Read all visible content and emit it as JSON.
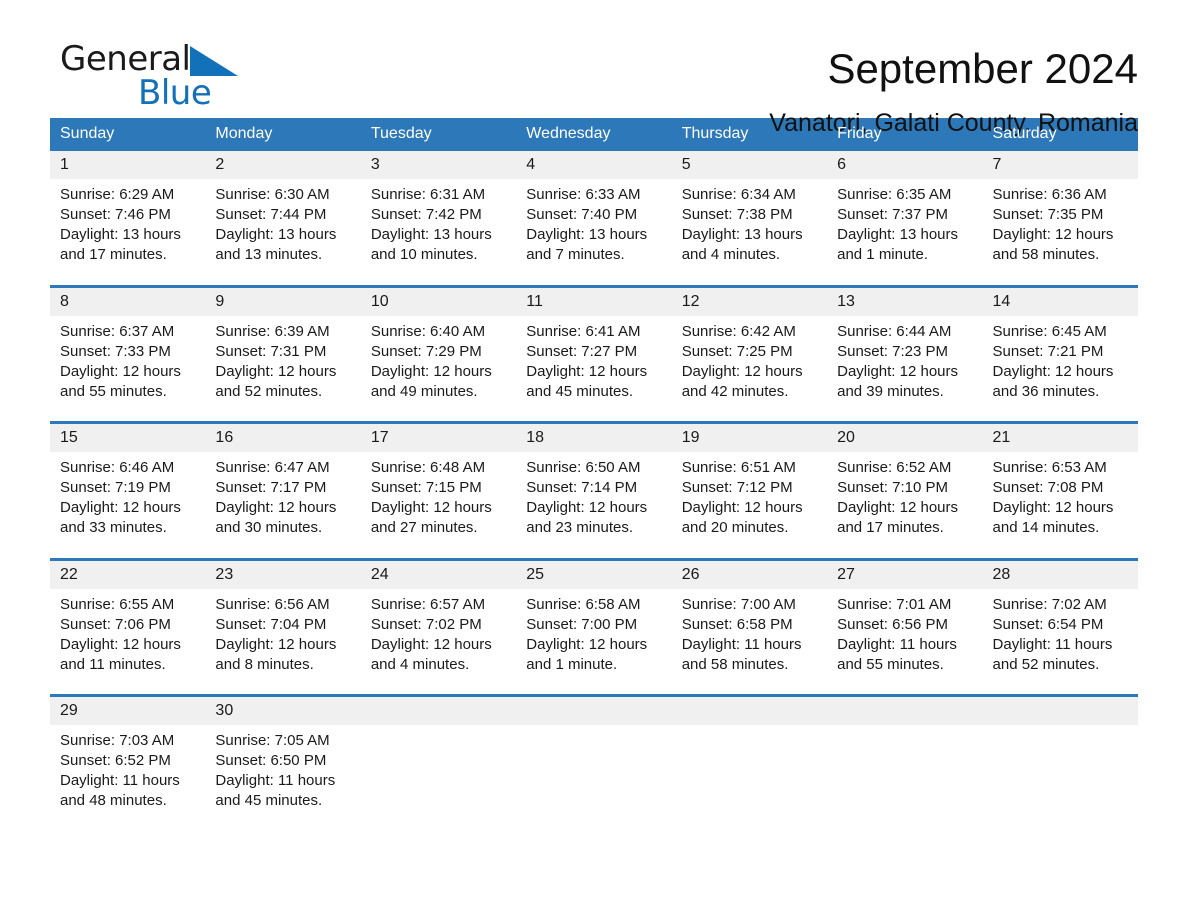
{
  "logo": {
    "text_dark": "General",
    "text_blue": "Blue",
    "triangle_color": "#1271b8",
    "icon": "triangle-icon"
  },
  "header": {
    "title": "September 2024",
    "subtitle": "Vanatori, Galati County, Romania"
  },
  "colors": {
    "header_blue": "#2c78b8",
    "daynum_band": "#f0f0f0",
    "text": "#1a1a1a",
    "page_background": "#ffffff"
  },
  "calendar": {
    "weekday_headers": [
      "Sunday",
      "Monday",
      "Tuesday",
      "Wednesday",
      "Thursday",
      "Friday",
      "Saturday"
    ],
    "weeks": [
      [
        {
          "day": "1",
          "sunrise": "Sunrise: 6:29 AM",
          "sunset": "Sunset: 7:46 PM",
          "daylight_line1": "Daylight: 13 hours",
          "daylight_line2": "and 17 minutes."
        },
        {
          "day": "2",
          "sunrise": "Sunrise: 6:30 AM",
          "sunset": "Sunset: 7:44 PM",
          "daylight_line1": "Daylight: 13 hours",
          "daylight_line2": "and 13 minutes."
        },
        {
          "day": "3",
          "sunrise": "Sunrise: 6:31 AM",
          "sunset": "Sunset: 7:42 PM",
          "daylight_line1": "Daylight: 13 hours",
          "daylight_line2": "and 10 minutes."
        },
        {
          "day": "4",
          "sunrise": "Sunrise: 6:33 AM",
          "sunset": "Sunset: 7:40 PM",
          "daylight_line1": "Daylight: 13 hours",
          "daylight_line2": "and 7 minutes."
        },
        {
          "day": "5",
          "sunrise": "Sunrise: 6:34 AM",
          "sunset": "Sunset: 7:38 PM",
          "daylight_line1": "Daylight: 13 hours",
          "daylight_line2": "and 4 minutes."
        },
        {
          "day": "6",
          "sunrise": "Sunrise: 6:35 AM",
          "sunset": "Sunset: 7:37 PM",
          "daylight_line1": "Daylight: 13 hours",
          "daylight_line2": "and 1 minute."
        },
        {
          "day": "7",
          "sunrise": "Sunrise: 6:36 AM",
          "sunset": "Sunset: 7:35 PM",
          "daylight_line1": "Daylight: 12 hours",
          "daylight_line2": "and 58 minutes."
        }
      ],
      [
        {
          "day": "8",
          "sunrise": "Sunrise: 6:37 AM",
          "sunset": "Sunset: 7:33 PM",
          "daylight_line1": "Daylight: 12 hours",
          "daylight_line2": "and 55 minutes."
        },
        {
          "day": "9",
          "sunrise": "Sunrise: 6:39 AM",
          "sunset": "Sunset: 7:31 PM",
          "daylight_line1": "Daylight: 12 hours",
          "daylight_line2": "and 52 minutes."
        },
        {
          "day": "10",
          "sunrise": "Sunrise: 6:40 AM",
          "sunset": "Sunset: 7:29 PM",
          "daylight_line1": "Daylight: 12 hours",
          "daylight_line2": "and 49 minutes."
        },
        {
          "day": "11",
          "sunrise": "Sunrise: 6:41 AM",
          "sunset": "Sunset: 7:27 PM",
          "daylight_line1": "Daylight: 12 hours",
          "daylight_line2": "and 45 minutes."
        },
        {
          "day": "12",
          "sunrise": "Sunrise: 6:42 AM",
          "sunset": "Sunset: 7:25 PM",
          "daylight_line1": "Daylight: 12 hours",
          "daylight_line2": "and 42 minutes."
        },
        {
          "day": "13",
          "sunrise": "Sunrise: 6:44 AM",
          "sunset": "Sunset: 7:23 PM",
          "daylight_line1": "Daylight: 12 hours",
          "daylight_line2": "and 39 minutes."
        },
        {
          "day": "14",
          "sunrise": "Sunrise: 6:45 AM",
          "sunset": "Sunset: 7:21 PM",
          "daylight_line1": "Daylight: 12 hours",
          "daylight_line2": "and 36 minutes."
        }
      ],
      [
        {
          "day": "15",
          "sunrise": "Sunrise: 6:46 AM",
          "sunset": "Sunset: 7:19 PM",
          "daylight_line1": "Daylight: 12 hours",
          "daylight_line2": "and 33 minutes."
        },
        {
          "day": "16",
          "sunrise": "Sunrise: 6:47 AM",
          "sunset": "Sunset: 7:17 PM",
          "daylight_line1": "Daylight: 12 hours",
          "daylight_line2": "and 30 minutes."
        },
        {
          "day": "17",
          "sunrise": "Sunrise: 6:48 AM",
          "sunset": "Sunset: 7:15 PM",
          "daylight_line1": "Daylight: 12 hours",
          "daylight_line2": "and 27 minutes."
        },
        {
          "day": "18",
          "sunrise": "Sunrise: 6:50 AM",
          "sunset": "Sunset: 7:14 PM",
          "daylight_line1": "Daylight: 12 hours",
          "daylight_line2": "and 23 minutes."
        },
        {
          "day": "19",
          "sunrise": "Sunrise: 6:51 AM",
          "sunset": "Sunset: 7:12 PM",
          "daylight_line1": "Daylight: 12 hours",
          "daylight_line2": "and 20 minutes."
        },
        {
          "day": "20",
          "sunrise": "Sunrise: 6:52 AM",
          "sunset": "Sunset: 7:10 PM",
          "daylight_line1": "Daylight: 12 hours",
          "daylight_line2": "and 17 minutes."
        },
        {
          "day": "21",
          "sunrise": "Sunrise: 6:53 AM",
          "sunset": "Sunset: 7:08 PM",
          "daylight_line1": "Daylight: 12 hours",
          "daylight_line2": "and 14 minutes."
        }
      ],
      [
        {
          "day": "22",
          "sunrise": "Sunrise: 6:55 AM",
          "sunset": "Sunset: 7:06 PM",
          "daylight_line1": "Daylight: 12 hours",
          "daylight_line2": "and 11 minutes."
        },
        {
          "day": "23",
          "sunrise": "Sunrise: 6:56 AM",
          "sunset": "Sunset: 7:04 PM",
          "daylight_line1": "Daylight: 12 hours",
          "daylight_line2": "and 8 minutes."
        },
        {
          "day": "24",
          "sunrise": "Sunrise: 6:57 AM",
          "sunset": "Sunset: 7:02 PM",
          "daylight_line1": "Daylight: 12 hours",
          "daylight_line2": "and 4 minutes."
        },
        {
          "day": "25",
          "sunrise": "Sunrise: 6:58 AM",
          "sunset": "Sunset: 7:00 PM",
          "daylight_line1": "Daylight: 12 hours",
          "daylight_line2": "and 1 minute."
        },
        {
          "day": "26",
          "sunrise": "Sunrise: 7:00 AM",
          "sunset": "Sunset: 6:58 PM",
          "daylight_line1": "Daylight: 11 hours",
          "daylight_line2": "and 58 minutes."
        },
        {
          "day": "27",
          "sunrise": "Sunrise: 7:01 AM",
          "sunset": "Sunset: 6:56 PM",
          "daylight_line1": "Daylight: 11 hours",
          "daylight_line2": "and 55 minutes."
        },
        {
          "day": "28",
          "sunrise": "Sunrise: 7:02 AM",
          "sunset": "Sunset: 6:54 PM",
          "daylight_line1": "Daylight: 11 hours",
          "daylight_line2": "and 52 minutes."
        }
      ],
      [
        {
          "day": "29",
          "sunrise": "Sunrise: 7:03 AM",
          "sunset": "Sunset: 6:52 PM",
          "daylight_line1": "Daylight: 11 hours",
          "daylight_line2": "and 48 minutes."
        },
        {
          "day": "30",
          "sunrise": "Sunrise: 7:05 AM",
          "sunset": "Sunset: 6:50 PM",
          "daylight_line1": "Daylight: 11 hours",
          "daylight_line2": "and 45 minutes."
        },
        {
          "day": "",
          "sunrise": "",
          "sunset": "",
          "daylight_line1": "",
          "daylight_line2": ""
        },
        {
          "day": "",
          "sunrise": "",
          "sunset": "",
          "daylight_line1": "",
          "daylight_line2": ""
        },
        {
          "day": "",
          "sunrise": "",
          "sunset": "",
          "daylight_line1": "",
          "daylight_line2": ""
        },
        {
          "day": "",
          "sunrise": "",
          "sunset": "",
          "daylight_line1": "",
          "daylight_line2": ""
        },
        {
          "day": "",
          "sunrise": "",
          "sunset": "",
          "daylight_line1": "",
          "daylight_line2": ""
        }
      ]
    ]
  }
}
